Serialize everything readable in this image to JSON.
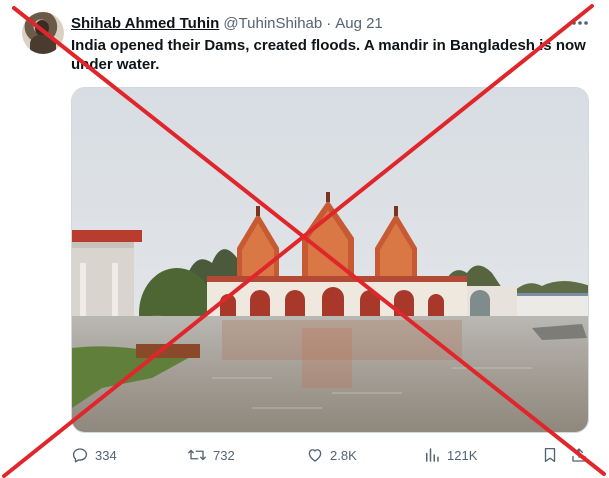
{
  "tweet": {
    "display_name": "Shihab Ahmed Tuhin",
    "handle": "@TuhinShihab",
    "separator": "·",
    "date": "Aug 21",
    "more_icon": "more-horizontal-icon",
    "text": "India opened their Dams, created floods. A mandir in Bangladesh is now under water."
  },
  "media": {
    "description_icon": "photo-flooded-temple"
  },
  "actions": {
    "replies": "334",
    "reposts": "732",
    "likes": "2.8K",
    "views": "121K",
    "reply_icon": "reply-icon",
    "repost_icon": "repost-icon",
    "like_icon": "heart-icon",
    "views_icon": "views-icon",
    "bookmark_icon": "bookmark-icon",
    "share_icon": "share-icon"
  },
  "overlay": {
    "cross_color": "#e0262a"
  }
}
